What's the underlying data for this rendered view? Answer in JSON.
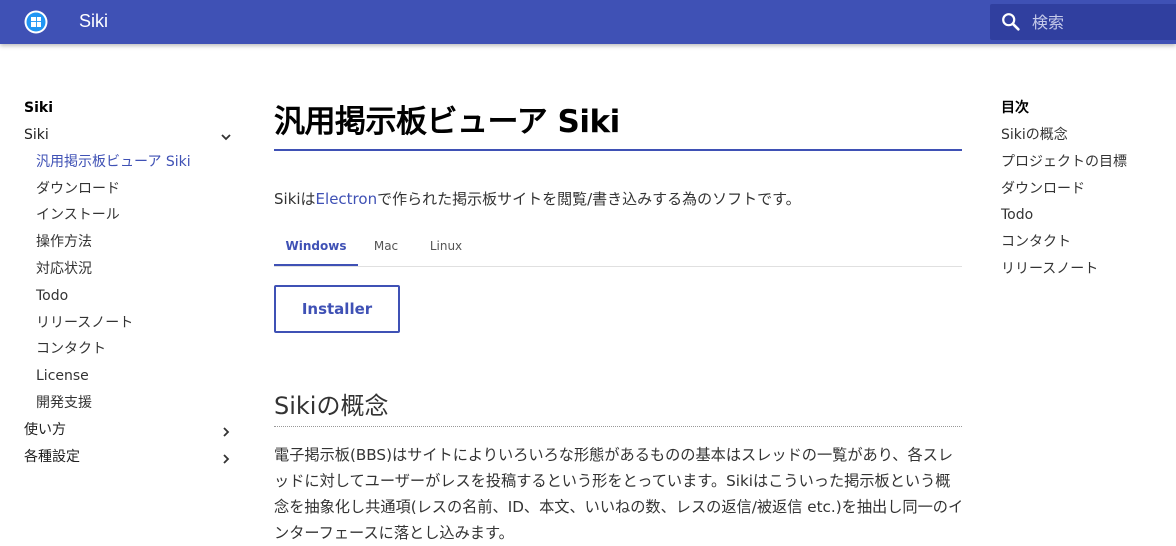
{
  "header": {
    "site_title": "Siki",
    "logo_icon": "siki-logo-icon",
    "search": {
      "icon": "search-icon",
      "placeholder": "検索"
    },
    "colors": {
      "primary": "#3f51b5",
      "primary_dark": "#303f9f"
    }
  },
  "nav": {
    "title": "Siki",
    "section_label": "Siki",
    "section_icon": "chevron-down-icon",
    "items": [
      "汎用掲示板ビューア Siki",
      "ダウンロード",
      "インストール",
      "操作方法",
      "対応状況",
      "Todo",
      "リリースノート",
      "コンタクト",
      "License",
      "開発支援"
    ],
    "collapsed_sections": [
      {
        "label": "使い方",
        "icon": "chevron-right-icon"
      },
      {
        "label": "各種設定",
        "icon": "chevron-right-icon"
      }
    ]
  },
  "main": {
    "title": "汎用掲示板ビューア Siki",
    "intro_before": "Sikiは",
    "intro_link": "Electron",
    "intro_after": "で作られた掲示板サイトを閲覧/書き込みする為のソフトです。",
    "tabs": [
      "Windows",
      "Mac",
      "Linux"
    ],
    "active_tab": "Windows",
    "installer_button": "Installer",
    "section_heading": "Sikiの概念",
    "paragraph": "電子掲示板(BBS)はサイトによりいろいろな形態があるものの基本はスレッドの一覧があり、各スレッドに対してユーザーがレスを投稿するという形をとっています。Sikiはこういった掲示板という概念を抽象化し共通項(レスの名前、ID、本文、いいねの数、レスの返信/被返信 etc.)を抽出し同一のインターフェースに落とし込みます。"
  },
  "toc": {
    "title": "目次",
    "items": [
      "Sikiの概念",
      "プロジェクトの目標",
      "ダウンロード",
      "Todo",
      "コンタクト",
      "リリースノート"
    ]
  }
}
